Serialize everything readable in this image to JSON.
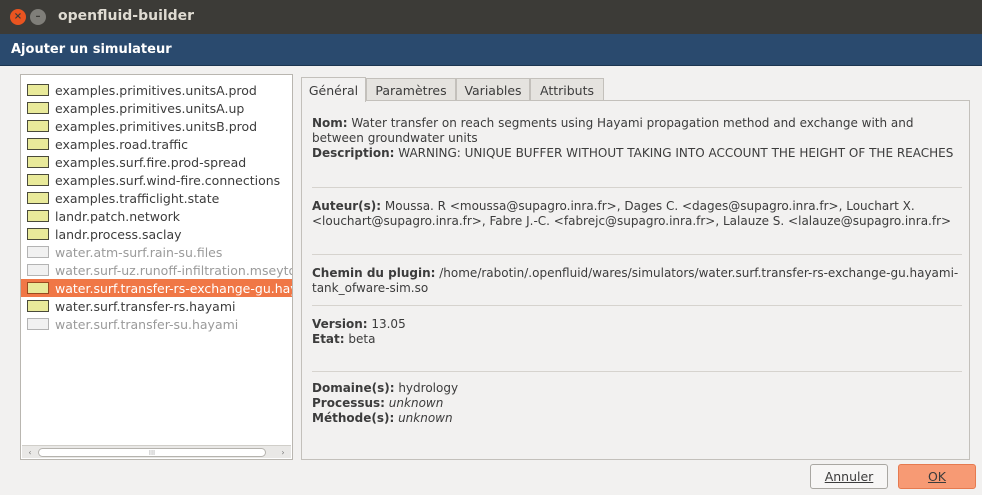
{
  "window": {
    "title": "openfluid-builder",
    "close_glyph": "×",
    "min_glyph": "–"
  },
  "dialog": {
    "title": "Ajouter un simulateur"
  },
  "simulators": [
    {
      "label": "examples.primitives.unitsA.prod",
      "state": "normal"
    },
    {
      "label": "examples.primitives.unitsA.up",
      "state": "normal"
    },
    {
      "label": "examples.primitives.unitsB.prod",
      "state": "normal"
    },
    {
      "label": "examples.road.traffic",
      "state": "normal"
    },
    {
      "label": "examples.surf.fire.prod-spread",
      "state": "normal"
    },
    {
      "label": "examples.surf.wind-fire.connections",
      "state": "normal"
    },
    {
      "label": "examples.trafficlight.state",
      "state": "normal"
    },
    {
      "label": "landr.patch.network",
      "state": "normal"
    },
    {
      "label": "landr.process.saclay",
      "state": "normal"
    },
    {
      "label": "water.atm-surf.rain-su.files",
      "state": "disabled"
    },
    {
      "label": "water.surf-uz.runoff-infiltration.mseytoux",
      "state": "disabled"
    },
    {
      "label": "water.surf.transfer-rs-exchange-gu.hayami",
      "state": "selected"
    },
    {
      "label": "water.surf.transfer-rs.hayami",
      "state": "normal"
    },
    {
      "label": "water.surf.transfer-su.hayami",
      "state": "disabled"
    }
  ],
  "scroll": {
    "left_arrow": "‹",
    "right_arrow": "›",
    "grip": "III"
  },
  "tabs": [
    {
      "label": "Général"
    },
    {
      "label": "Paramètres"
    },
    {
      "label": "Variables"
    },
    {
      "label": "Attributs"
    }
  ],
  "details": {
    "name_label": "Nom:",
    "name_value": " Water transfer on reach segments using Hayami propagation method and exchange with and between groundwater units",
    "description_label": "Description:",
    "description_value": " WARNING: UNIQUE BUFFER WITHOUT TAKING INTO ACCOUNT THE HEIGHT OF THE REACHES",
    "authors_label": "Auteur(s):",
    "authors_value": " Moussa. R <moussa@supagro.inra.fr>, Dages C. <dages@supagro.inra.fr>, Louchart X. <louchart@supagro.inra.fr>, Fabre J.-C. <fabrejc@supagro.inra.fr>, Lalauze S. <lalauze@supagro.inra.fr>",
    "path_label": "Chemin du plugin:",
    "path_value": " /home/rabotin/.openfluid/wares/simulators/water.surf.transfer-rs-exchange-gu.hayami-tank_ofware-sim.so",
    "version_label": "Version:",
    "version_value": " 13.05",
    "state_label": "Etat:",
    "state_value": " beta",
    "domain_label": "Domaine(s):",
    "domain_value": " hydrology",
    "process_label": "Processus:",
    "process_value": " unknown",
    "method_label": "Méthode(s):",
    "method_value": " unknown"
  },
  "buttons": {
    "cancel_label": "Annuler",
    "ok_label": "OK"
  }
}
